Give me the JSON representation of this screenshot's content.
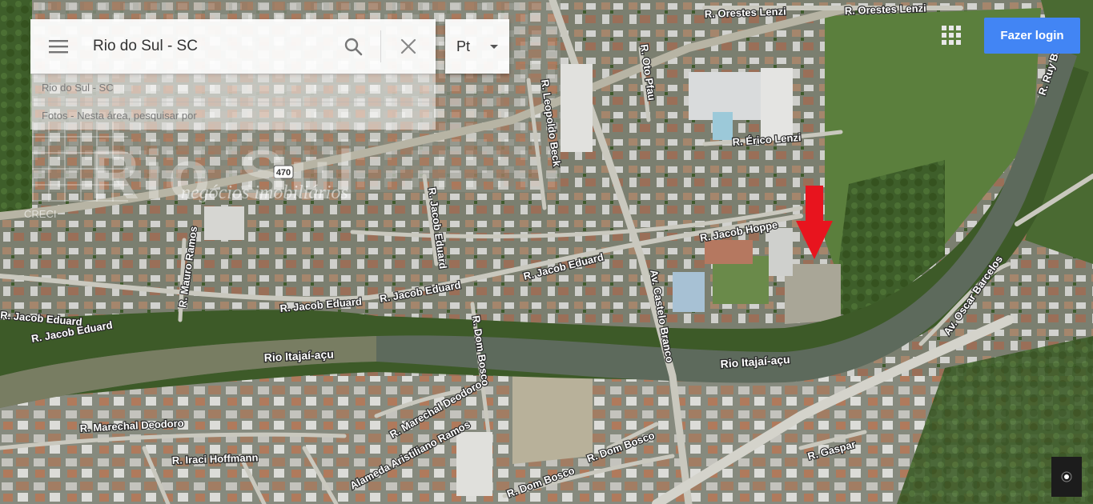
{
  "search": {
    "value": "Rio do Sul - SC",
    "suggestions": [
      "Rio do Sul - SC",
      "Fotos - Nesta área, pesquisar por"
    ]
  },
  "language": {
    "selected": "Pt"
  },
  "login": {
    "label": "Fazer login"
  },
  "watermark": {
    "brand": "Rio Sul",
    "tagline": "negócios imobiliários",
    "creci": "CRECI"
  },
  "map": {
    "street_labels": [
      "R. Orestes Lenzi",
      "R. Orestes Lenzi",
      "R. Oto Pfau",
      "R. Leopoldo Beck",
      "R. Érico Lenzi",
      "R. Jacob Hoppe",
      "R. Jacob Eduard",
      "R. Jacob Eduard",
      "R. Jacob Eduard",
      "R. Jacob Eduard",
      "Av. Castelo Branco",
      "R. Jacob Eduard",
      "R. Dom Bosco",
      "R. Dom Bosco",
      "R. Dom Bosco",
      "Av. Oscar Barcelos",
      "R. Marechal Deodoro",
      "R. Marechal Deodoro",
      "Alameda Aristiliano Ramos",
      "R. Gaspar",
      "R. Iraci Hoffmann",
      "R. Mauro Ramos",
      "R. Ruy Barbosa",
      "R. Jacob Eduard"
    ],
    "river_labels": [
      "Rio Itajaí-açu",
      "Rio Itajaí-açu"
    ],
    "highway_marker": "470",
    "colors": {
      "urban": "#7d8173",
      "vegetation": "#4a6a32",
      "river": "#5b6659",
      "road": "#c7c6bd",
      "pin": "#e8141e"
    }
  }
}
